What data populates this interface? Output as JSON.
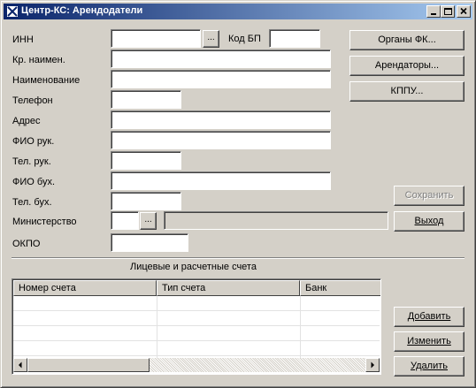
{
  "window": {
    "title": "Центр-КС: Арендодатели",
    "controls": [
      "minimize-icon",
      "maximize-icon",
      "close-icon"
    ]
  },
  "form": {
    "inn_label": "ИНН",
    "inn_value": "",
    "inn_lookup": "...",
    "kod_bp_label": "Код БП",
    "kod_bp_value": "",
    "short_name_label": "Кр. наимен.",
    "short_name_value": "",
    "name_label": "Наименование",
    "name_value": "",
    "phone_label": "Телефон",
    "phone_value": "",
    "address_label": "Адрес",
    "address_value": "",
    "head_name_label": "ФИО рук.",
    "head_name_value": "",
    "head_phone_label": "Тел. рук.",
    "head_phone_value": "",
    "accountant_name_label": "ФИО бух.",
    "accountant_name_value": "",
    "accountant_phone_label": "Тел. бух.",
    "accountant_phone_value": "",
    "ministry_label": "Министерство",
    "ministry_code_value": "",
    "ministry_lookup": "...",
    "ministry_name_value": "",
    "okpo_label": "ОКПО",
    "okpo_value": ""
  },
  "side_buttons": {
    "organs_fk": "Органы ФК...",
    "tenants": "Арендаторы...",
    "kppu": "КППУ...",
    "save": "Сохранить",
    "exit": "Выход"
  },
  "accounts": {
    "section_title": "Лицевые и расчетные счета",
    "columns": [
      "Номер счета",
      "Тип счета",
      "Банк"
    ],
    "rows": []
  },
  "account_buttons": {
    "add": "Добавить",
    "edit": "Изменить",
    "delete": "Удалить"
  },
  "colors": {
    "title_bar_start": "#0a246a",
    "title_bar_end": "#a6caf0",
    "window_face": "#d4d0c8"
  }
}
